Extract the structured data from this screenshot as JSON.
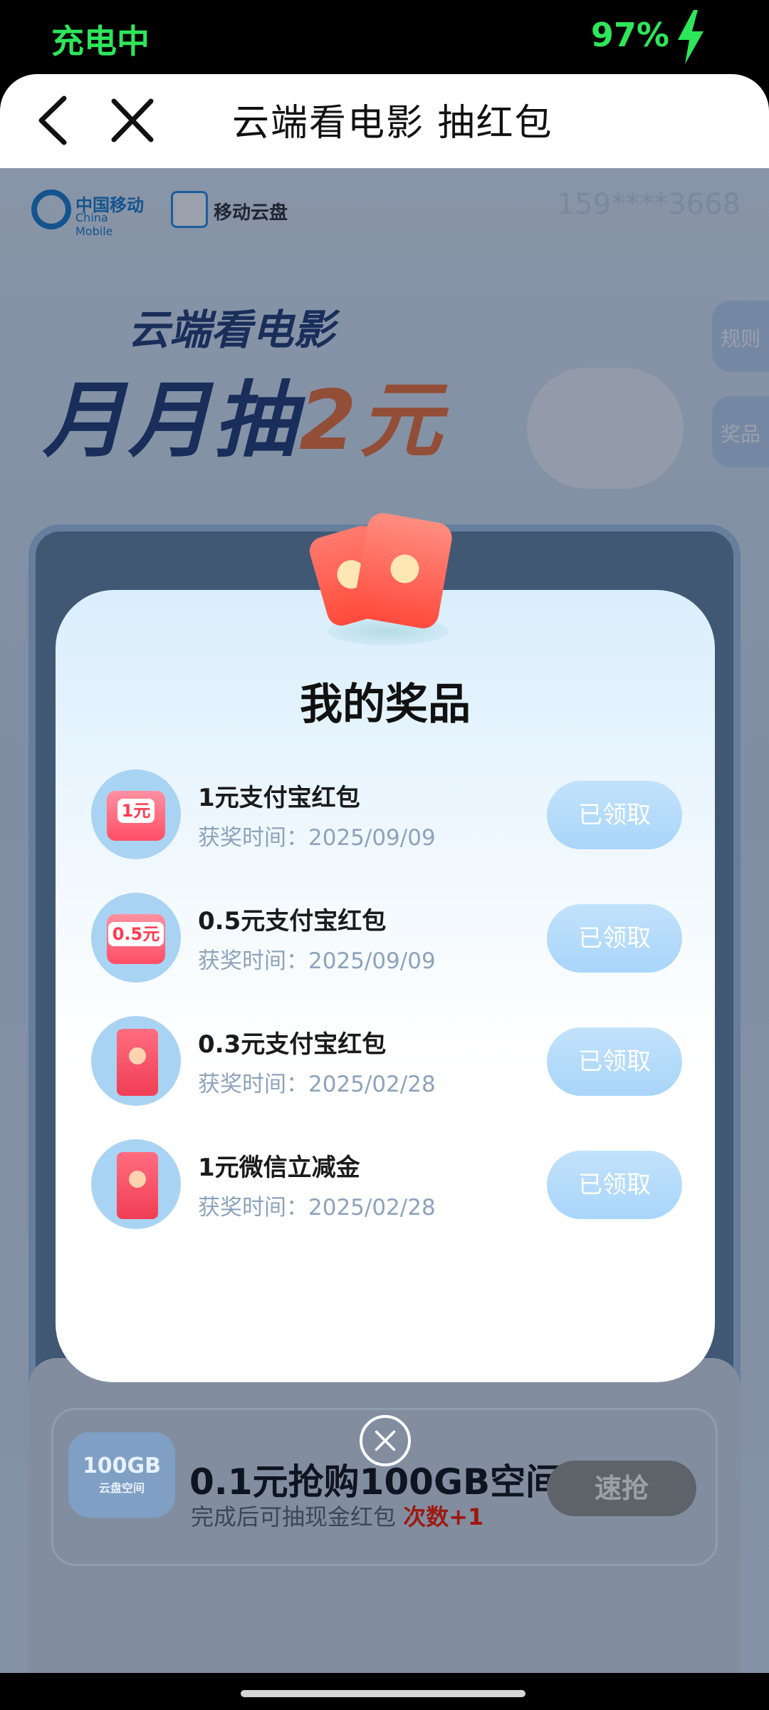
{
  "status_bar": {
    "charging": "充电中",
    "battery": "97%"
  },
  "topbar": {
    "title": "云端看电影 抽红包"
  },
  "page": {
    "brand_cm": "中国移动",
    "brand_cm_en": "China Mobile",
    "brand_cloud": "移动云盘",
    "phone": "159****3668",
    "hero_sub": "云端看电影",
    "hero_main_a": "月月抽",
    "hero_main_b": "2元",
    "side_rules": "规则",
    "side_prizes": "奖品"
  },
  "modal": {
    "title": "我的奖品",
    "prizes": [
      {
        "name": "1元支付宝红包",
        "time": "获奖时间：2025/09/09",
        "button": "已领取",
        "badge": "1元",
        "icon": "red-envelope-1yuan-icon"
      },
      {
        "name": "0.5元支付宝红包",
        "time": "获奖时间：2025/09/09",
        "button": "已领取",
        "badge": "0.5元",
        "icon": "red-envelope-05yuan-icon"
      },
      {
        "name": "0.3元支付宝红包",
        "time": "获奖时间：2025/02/28",
        "button": "已领取",
        "icon": "red-envelope-icon"
      },
      {
        "name": "1元微信立减金",
        "time": "获奖时间：2025/02/28",
        "button": "已领取",
        "icon": "red-envelope-icon"
      }
    ]
  },
  "promo": {
    "badge": "100GB",
    "badge_sub": "云盘空间",
    "title": "0.1元抢购100GB空间",
    "desc": "完成后可抽现金红包",
    "desc_highlight": "次数+1",
    "button": "速抢"
  },
  "colors": {
    "status_green": "#2ee65a",
    "accent_orange": "#f06a2a",
    "button_blue": "#a9d5fa"
  }
}
